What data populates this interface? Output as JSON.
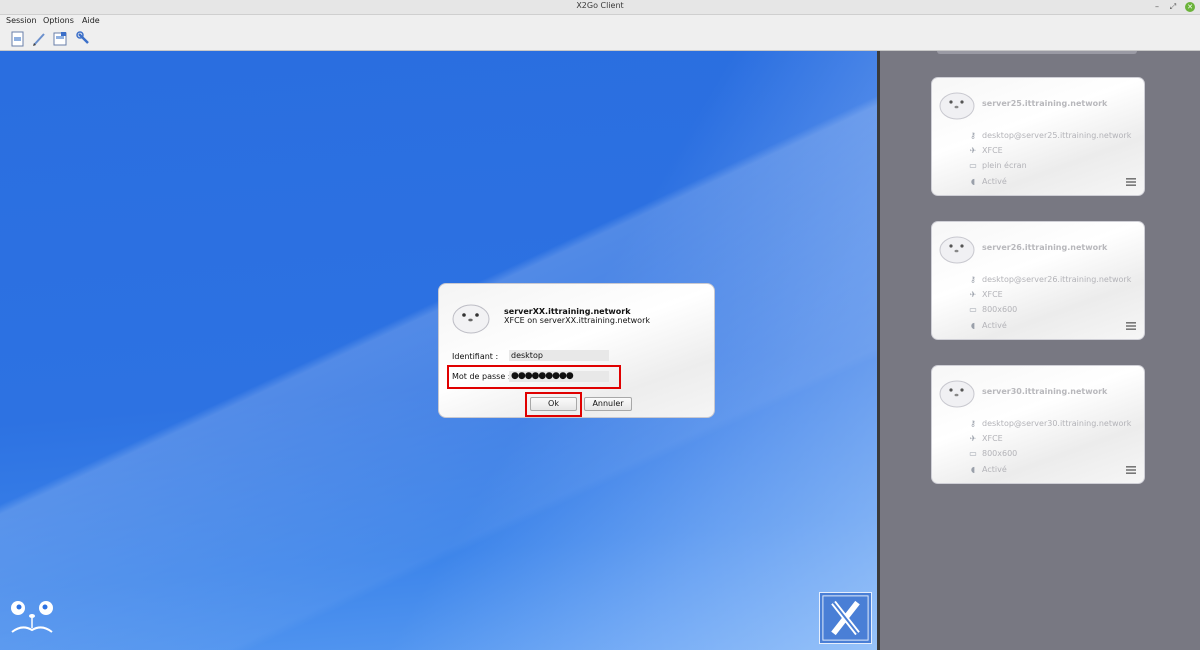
{
  "window": {
    "title": "X2Go Client"
  },
  "menu": {
    "items": [
      {
        "label": "Session"
      },
      {
        "label": "Options"
      },
      {
        "label": "Aide"
      }
    ]
  },
  "toolbar": {
    "icons": [
      "new-session-icon",
      "edit-session-icon",
      "session-manage-icon",
      "preferences-icon"
    ]
  },
  "login_dialog": {
    "server": "serverXX.ittraining.network",
    "subtitle": "XFCE on serverXX.ittraining.network",
    "username_label": "Identifiant :",
    "username_value": "desktop",
    "password_label": "Mot de passe :",
    "password_value": "●●●●●●●●●",
    "ok_label": "Ok",
    "cancel_label": "Annuler"
  },
  "sessions": [
    {
      "server": "server25.ittraining.network",
      "login": "desktop@server25.ittraining.network",
      "desktop": "XFCE",
      "display": "plein écran",
      "sound": "Activé"
    },
    {
      "server": "server26.ittraining.network",
      "login": "desktop@server26.ittraining.network",
      "desktop": "XFCE",
      "display": "800x600",
      "sound": "Activé"
    },
    {
      "server": "server30.ittraining.network",
      "login": "desktop@server30.ittraining.network",
      "desktop": "XFCE",
      "display": "800x600",
      "sound": "Activé"
    }
  ],
  "colors": {
    "highlight": "#e00000",
    "desktop_blue": "#2d72e2",
    "panel_bg": "#787882"
  }
}
